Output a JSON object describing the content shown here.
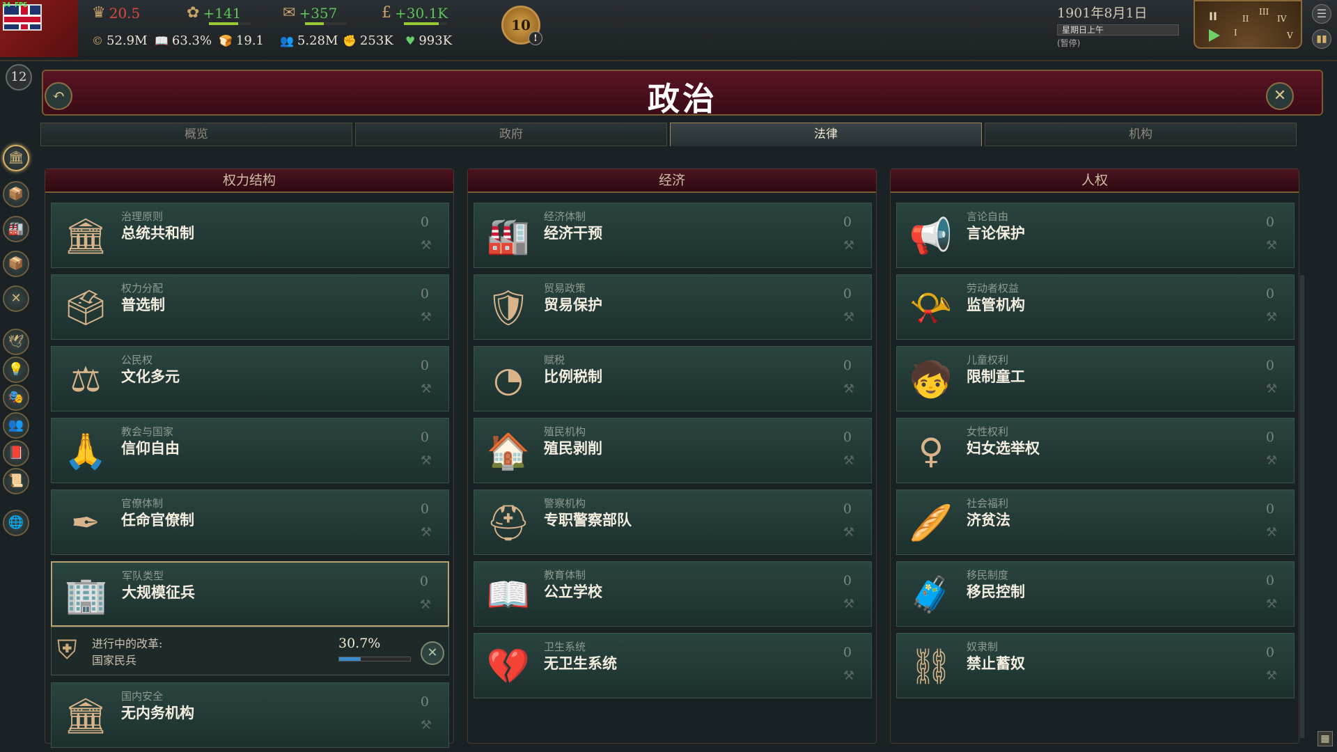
{
  "overlay": {
    "fps": "34 FPS"
  },
  "stats_top": [
    {
      "icon": "prestige-icon",
      "value": "20.5",
      "color": "red"
    },
    {
      "icon": "influence-icon",
      "value": "+141",
      "color": "green"
    },
    {
      "icon": "bureaucracy-icon",
      "value": "+357",
      "color": "green"
    },
    {
      "icon": "treasury-icon",
      "value": "+30.1K",
      "color": "green"
    }
  ],
  "stats_bottom": [
    {
      "icon": "gdp-icon",
      "value": "52.9M"
    },
    {
      "icon": "literacy-icon",
      "value": "63.3%"
    },
    {
      "icon": "sol-icon",
      "value": "19.1"
    },
    {
      "icon": "population-icon",
      "value": "5.28M"
    },
    {
      "icon": "army-icon",
      "value": "253K"
    },
    {
      "icon": "legitimacy-icon",
      "value": "993K"
    }
  ],
  "medal": {
    "value": "10",
    "alert": "!"
  },
  "date": {
    "date": "1901年8月1日",
    "weekday": "星期日上午",
    "paused": "(暂停)"
  },
  "clock": {
    "pause_label": "II",
    "roman": [
      "I",
      "II",
      "III",
      "IV",
      "V"
    ]
  },
  "level_badge": "12",
  "title": "政治",
  "tabs": [
    {
      "label": "概览",
      "active": false
    },
    {
      "label": "政府",
      "active": false
    },
    {
      "label": "法律",
      "active": true
    },
    {
      "label": "机构",
      "active": false
    }
  ],
  "columns": [
    {
      "header": "权力结构",
      "laws": [
        {
          "category": "治理原则",
          "name": "总统共和制",
          "icon": "building-icon",
          "glyph": "🏛",
          "value": "0",
          "sub": "⚒"
        },
        {
          "category": "权力分配",
          "name": "普选制",
          "icon": "ballot-box-icon",
          "glyph": "🗳",
          "value": "0",
          "sub": "⚒"
        },
        {
          "category": "公民权",
          "name": "文化多元",
          "icon": "scales-icon",
          "glyph": "⚖",
          "value": "0",
          "sub": "⚒"
        },
        {
          "category": "教会与国家",
          "name": "信仰自由",
          "icon": "praying-hands-icon",
          "glyph": "🙏",
          "value": "0",
          "sub": "⚒"
        },
        {
          "category": "官僚体制",
          "name": "任命官僚制",
          "icon": "quill-icon",
          "glyph": "✒",
          "value": "0",
          "sub": "⚒"
        },
        {
          "category": "军队类型",
          "name": "大规模征兵",
          "icon": "barracks-icon",
          "glyph": "🏢",
          "value": "0",
          "sub": "⚒"
        },
        {
          "category": "国内安全",
          "name": "无内务机构",
          "icon": "temple-icon",
          "glyph": "🏛",
          "value": "0",
          "sub": "⚒"
        }
      ],
      "reform": {
        "label": "进行中的改革:",
        "value": "国家民兵",
        "percent": "30.7%",
        "progress": 0.307
      }
    },
    {
      "header": "经济",
      "laws": [
        {
          "category": "经济体制",
          "name": "经济干预",
          "icon": "factory-icon",
          "glyph": "🏭",
          "value": "0",
          "sub": "⚒"
        },
        {
          "category": "贸易政策",
          "name": "贸易保护",
          "icon": "shield-factory-icon",
          "glyph": "🛡",
          "value": "0",
          "sub": "⚒"
        },
        {
          "category": "赋税",
          "name": "比例税制",
          "icon": "pie-icon",
          "glyph": "◔",
          "value": "0",
          "sub": "⚒"
        },
        {
          "category": "殖民机构",
          "name": "殖民剥削",
          "icon": "colony-house-icon",
          "glyph": "🏠",
          "value": "0",
          "sub": "⚒"
        },
        {
          "category": "警察机构",
          "name": "专职警察部队",
          "icon": "police-helmet-icon",
          "glyph": "⛑",
          "value": "0",
          "sub": "⚒"
        },
        {
          "category": "教育体制",
          "name": "公立学校",
          "icon": "book-icon",
          "glyph": "📖",
          "value": "0",
          "sub": "⚒"
        },
        {
          "category": "卫生系统",
          "name": "无卫生系统",
          "icon": "broken-heart-icon",
          "glyph": "💔",
          "value": "0",
          "sub": "⚒"
        }
      ]
    },
    {
      "header": "人权",
      "laws": [
        {
          "category": "言论自由",
          "name": "言论保护",
          "icon": "megaphone-icon",
          "glyph": "📢",
          "value": "0",
          "sub": "⚒"
        },
        {
          "category": "劳动者权益",
          "name": "监管机构",
          "icon": "whistle-icon",
          "glyph": "📯",
          "value": "0",
          "sub": "⚒"
        },
        {
          "category": "儿童权利",
          "name": "限制童工",
          "icon": "child-icon",
          "glyph": "🧒",
          "value": "0",
          "sub": "⚒"
        },
        {
          "category": "女性权利",
          "name": "妇女选举权",
          "icon": "female-symbol-icon",
          "glyph": "♀",
          "value": "0",
          "sub": "⚒"
        },
        {
          "category": "社会福利",
          "name": "济贫法",
          "icon": "bread-icon",
          "glyph": "🥖",
          "value": "0",
          "sub": "⚒"
        },
        {
          "category": "移民制度",
          "name": "移民控制",
          "icon": "migrant-icon",
          "glyph": "🧳",
          "value": "0",
          "sub": "⚒"
        },
        {
          "category": "奴隶制",
          "name": "禁止蓄奴",
          "icon": "broken-chain-icon",
          "glyph": "⛓",
          "value": "0",
          "sub": "⚒"
        }
      ]
    }
  ],
  "rail": [
    {
      "icon": "government-icon",
      "glyph": "🏛"
    },
    {
      "icon": "economy-icon",
      "glyph": "📦"
    },
    {
      "icon": "industry-icon",
      "glyph": "🏭"
    },
    {
      "icon": "market-icon",
      "glyph": "📦"
    },
    {
      "icon": "military-icon",
      "glyph": "✕"
    },
    {
      "icon": "diplomacy-icon",
      "glyph": "🕊"
    },
    {
      "icon": "technology-icon",
      "glyph": "💡"
    },
    {
      "icon": "politics-icon",
      "glyph": "🎭"
    },
    {
      "icon": "population-icon",
      "glyph": "👥"
    },
    {
      "icon": "journal-icon",
      "glyph": "📕"
    },
    {
      "icon": "ledger-icon",
      "glyph": "📜"
    },
    {
      "icon": "world-icon",
      "glyph": "🌐"
    }
  ]
}
